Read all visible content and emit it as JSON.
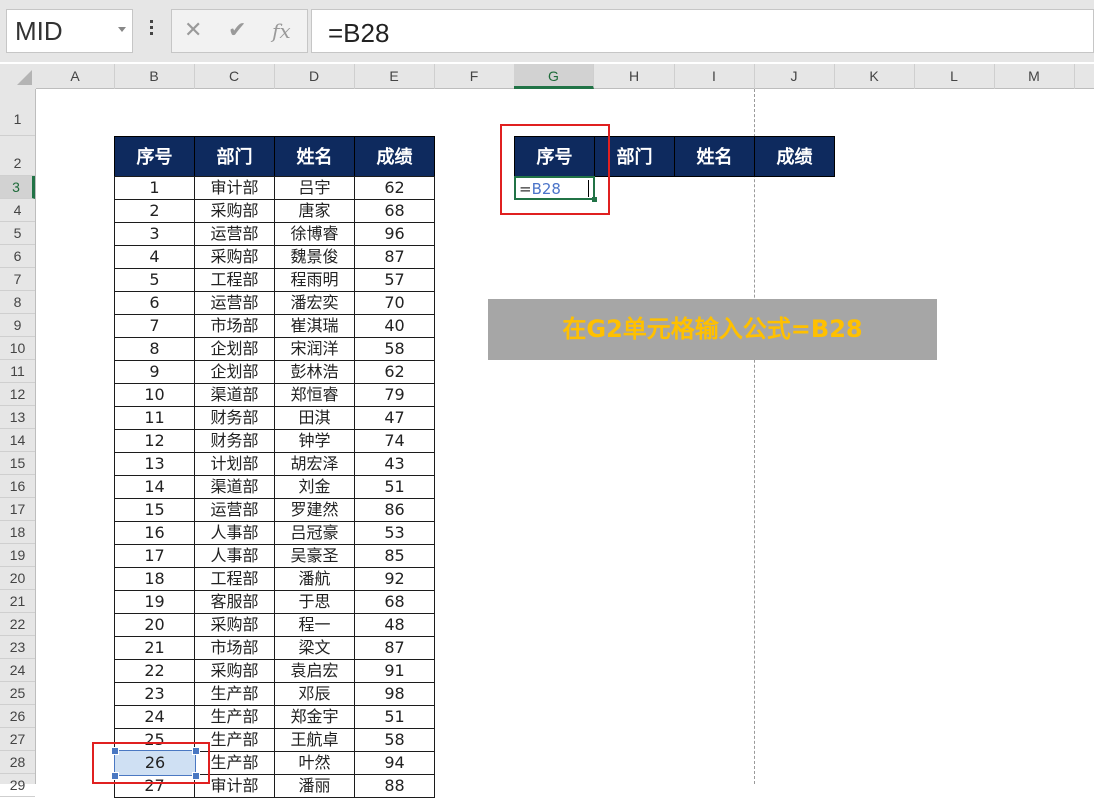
{
  "name_box": {
    "value": "MID"
  },
  "formula_bar": {
    "cancel_glyph": "✕",
    "enter_glyph": "✔",
    "fx_glyph": "fx",
    "content": "=B28"
  },
  "columns": [
    "A",
    "B",
    "C",
    "D",
    "E",
    "F",
    "G",
    "H",
    "I",
    "J",
    "K",
    "L",
    "M"
  ],
  "selected_column": "G",
  "rows": [
    "1",
    "2",
    "3",
    "4",
    "5",
    "6",
    "7",
    "8",
    "9",
    "10",
    "11",
    "12",
    "13",
    "14",
    "15",
    "16",
    "17",
    "18",
    "19",
    "20",
    "21",
    "22",
    "23",
    "24",
    "25",
    "26",
    "27",
    "28",
    "29"
  ],
  "selected_row": "3",
  "source_table": {
    "headers": [
      "序号",
      "部门",
      "姓名",
      "成绩"
    ],
    "rows": [
      [
        "1",
        "审计部",
        "吕宇",
        "62"
      ],
      [
        "2",
        "采购部",
        "唐家",
        "68"
      ],
      [
        "3",
        "运营部",
        "徐博睿",
        "96"
      ],
      [
        "4",
        "采购部",
        "魏景俊",
        "87"
      ],
      [
        "5",
        "工程部",
        "程雨明",
        "57"
      ],
      [
        "6",
        "运营部",
        "潘宏奕",
        "70"
      ],
      [
        "7",
        "市场部",
        "崔淇瑞",
        "40"
      ],
      [
        "8",
        "企划部",
        "宋润洋",
        "58"
      ],
      [
        "9",
        "企划部",
        "彭林浩",
        "62"
      ],
      [
        "10",
        "渠道部",
        "郑恒睿",
        "79"
      ],
      [
        "11",
        "财务部",
        "田淇",
        "47"
      ],
      [
        "12",
        "财务部",
        "钟学",
        "74"
      ],
      [
        "13",
        "计划部",
        "胡宏泽",
        "43"
      ],
      [
        "14",
        "渠道部",
        "刘金",
        "51"
      ],
      [
        "15",
        "运营部",
        "罗建然",
        "86"
      ],
      [
        "16",
        "人事部",
        "吕冠豪",
        "53"
      ],
      [
        "17",
        "人事部",
        "吴豪圣",
        "85"
      ],
      [
        "18",
        "工程部",
        "潘航",
        "92"
      ],
      [
        "19",
        "客服部",
        "于思",
        "68"
      ],
      [
        "20",
        "采购部",
        "程一",
        "48"
      ],
      [
        "21",
        "市场部",
        "梁文",
        "87"
      ],
      [
        "22",
        "采购部",
        "袁启宏",
        "91"
      ],
      [
        "23",
        "生产部",
        "邓辰",
        "98"
      ],
      [
        "24",
        "生产部",
        "郑金宇",
        "51"
      ],
      [
        "25",
        "生产部",
        "王航卓",
        "58"
      ],
      [
        "26",
        "生产部",
        "叶然",
        "94"
      ],
      [
        "27",
        "审计部",
        "潘丽",
        "88"
      ]
    ]
  },
  "target_table": {
    "headers": [
      "序号",
      "部门",
      "姓名",
      "成绩"
    ],
    "editing_cell": {
      "equals": "=",
      "ref": "B28"
    }
  },
  "banner": {
    "text": "在G2单元格输入公式=B28"
  },
  "colors": {
    "header_fill": "#0e2a5e",
    "banner_fill": "#a6a6a6",
    "banner_text": "#ffc000",
    "highlight_box": "#e02020",
    "excel_green": "#217346"
  }
}
